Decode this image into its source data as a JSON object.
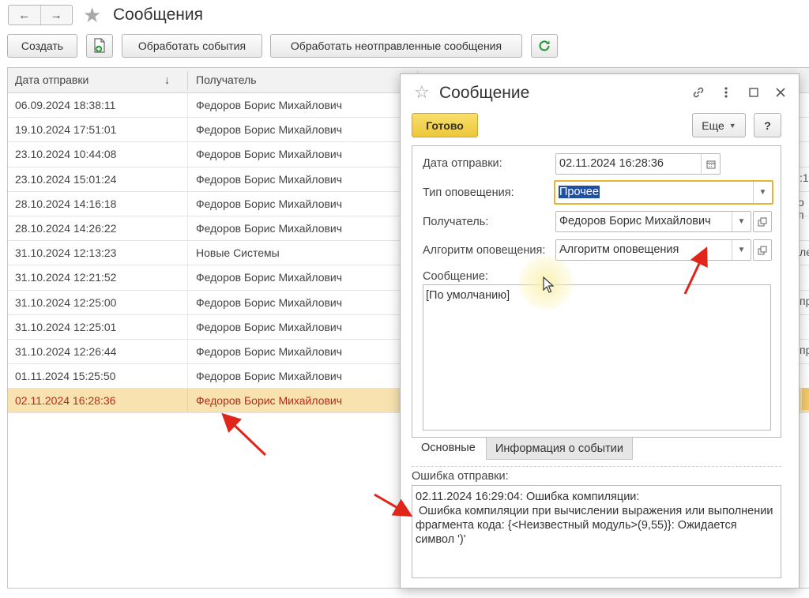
{
  "header": {
    "back": "←",
    "forward": "→",
    "title": "Сообщения"
  },
  "toolbar": {
    "create": "Создать",
    "process_events": "Обработать события",
    "process_unsent": "Обработать неотправленные сообщения"
  },
  "table": {
    "columns": [
      "Дата отправки",
      "Получатель"
    ],
    "sort_indicator": "↓",
    "rows": [
      {
        "date": "06.09.2024 18:38:11",
        "recipient": "Федоров Борис Михайлович"
      },
      {
        "date": "19.10.2024 17:51:01",
        "recipient": "Федоров Борис Михайлович"
      },
      {
        "date": "23.10.2024 10:44:08",
        "recipient": "Федоров Борис Михайлович"
      },
      {
        "date": "23.10.2024 15:01:24",
        "recipient": "Федоров Борис Михайлович"
      },
      {
        "date": "28.10.2024 14:16:18",
        "recipient": "Федоров Борис Михайлович"
      },
      {
        "date": "28.10.2024 14:26:22",
        "recipient": "Федоров Борис Михайлович"
      },
      {
        "date": "31.10.2024 12:13:23",
        "recipient": "Новые Системы"
      },
      {
        "date": "31.10.2024 12:21:52",
        "recipient": "Федоров Борис Михайлович"
      },
      {
        "date": "31.10.2024 12:25:00",
        "recipient": "Федоров Борис Михайлович"
      },
      {
        "date": "31.10.2024 12:25:01",
        "recipient": "Федоров Борис Михайлович"
      },
      {
        "date": "31.10.2024 12:26:44",
        "recipient": "Федоров Борис Михайлович"
      },
      {
        "date": "01.11.2024 15:25:50",
        "recipient": "Федоров Борис Михайлович"
      },
      {
        "date": "02.11.2024 16:28:36",
        "recipient": "Федоров Борис Михайлович",
        "selected": true
      }
    ],
    "peek": [
      ":1",
      "о п",
      "ле",
      "пр",
      "пр"
    ]
  },
  "modal": {
    "title": "Сообщение",
    "ready": "Готово",
    "more": "Еще",
    "help": "?",
    "fields": {
      "date_label": "Дата отправки:",
      "date_value": "02.11.2024 16:28:36",
      "type_label": "Тип оповещения:",
      "type_value": "Прочее",
      "recipient_label": "Получатель:",
      "recipient_value": "Федоров Борис Михайлович",
      "algorithm_label": "Алгоритм оповещения:",
      "algorithm_value": "Алгоритм оповещения",
      "message_label": "Сообщение:",
      "message_value": "[По умолчанию]"
    },
    "tabs": [
      "Основные",
      "Информация о событии"
    ],
    "error_label": "Ошибка отправки:",
    "error_text": "02.11.2024 16:29:04: Ошибка компиляции:\n Ошибка компиляции при вычислении выражения или выполнении фрагмента кода: {<Неизвестный модуль>(9,55)}: Ожидается символ ')'"
  },
  "colors": {
    "accent_yellow": "#ecc73b",
    "selected_row": "#f8e3b0",
    "selected_text": "#b52b1b",
    "annotation_arrow": "#e0261a",
    "refresh_green": "#2e9a3c"
  }
}
